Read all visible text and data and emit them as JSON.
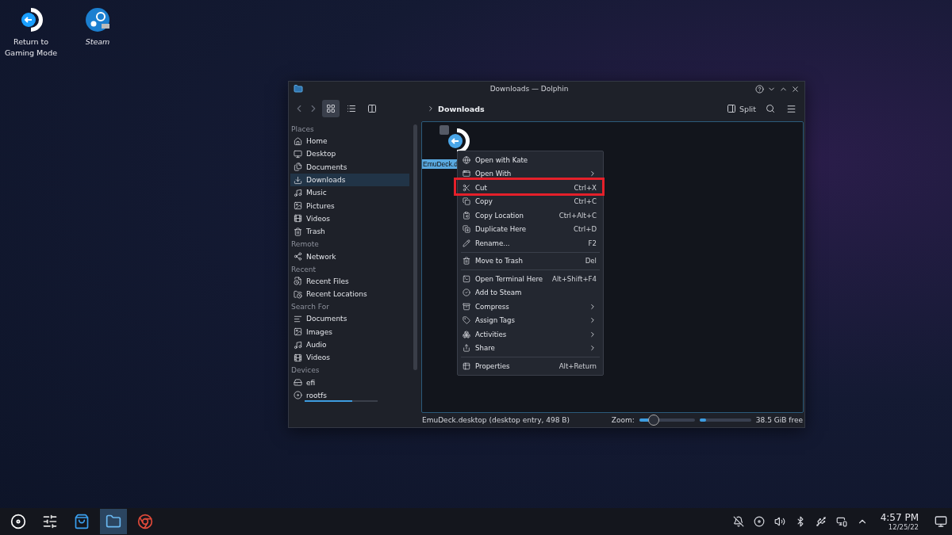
{
  "desktop_icons": [
    {
      "label": "Return to Gaming Mode",
      "italic": false
    },
    {
      "label": "Steam",
      "italic": true
    }
  ],
  "window": {
    "title": "Downloads — Dolphin",
    "view_modes": [
      {
        "selected": true
      },
      {
        "selected": false
      },
      {
        "selected": false
      }
    ],
    "breadcrumb": "Downloads",
    "split_label": "Split",
    "sidebar": [
      {
        "heading": "Places",
        "items": [
          {
            "label": "Home",
            "selected": false
          },
          {
            "label": "Desktop",
            "selected": false
          },
          {
            "label": "Documents",
            "selected": false
          },
          {
            "label": "Downloads",
            "selected": true
          },
          {
            "label": "Music",
            "selected": false
          },
          {
            "label": "Pictures",
            "selected": false
          },
          {
            "label": "Videos",
            "selected": false
          },
          {
            "label": "Trash",
            "selected": false
          }
        ]
      },
      {
        "heading": "Remote",
        "items": [
          {
            "label": "Network",
            "selected": false
          }
        ]
      },
      {
        "heading": "Recent",
        "items": [
          {
            "label": "Recent Files",
            "selected": false
          },
          {
            "label": "Recent Locations",
            "selected": false
          }
        ]
      },
      {
        "heading": "Search For",
        "items": [
          {
            "label": "Documents",
            "selected": false
          },
          {
            "label": "Images",
            "selected": false
          },
          {
            "label": "Audio",
            "selected": false
          },
          {
            "label": "Videos",
            "selected": false
          }
        ]
      },
      {
        "heading": "Devices",
        "items": [
          {
            "label": "efi",
            "selected": false
          },
          {
            "label": "rootfs",
            "selected": false,
            "level": 0.65
          }
        ]
      }
    ],
    "file": {
      "name": "EmuDeck.d",
      "selected": true
    },
    "context_menu": [
      {
        "kind": "item",
        "label": "Open with Kate"
      },
      {
        "kind": "item",
        "label": "Open With",
        "submenu": true
      },
      {
        "kind": "item",
        "label": "Cut",
        "shortcut": "Ctrl+X",
        "highlighted": true
      },
      {
        "kind": "item",
        "label": "Copy",
        "shortcut": "Ctrl+C"
      },
      {
        "kind": "item",
        "label": "Copy Location",
        "shortcut": "Ctrl+Alt+C"
      },
      {
        "kind": "item",
        "label": "Duplicate Here",
        "shortcut": "Ctrl+D"
      },
      {
        "kind": "item",
        "label": "Rename...",
        "shortcut": "F2"
      },
      {
        "kind": "separator"
      },
      {
        "kind": "item",
        "label": "Move to Trash",
        "shortcut": "Del"
      },
      {
        "kind": "separator"
      },
      {
        "kind": "item",
        "label": "Open Terminal Here",
        "shortcut": "Alt+Shift+F4"
      },
      {
        "kind": "item",
        "label": "Add to Steam"
      },
      {
        "kind": "item",
        "label": "Compress",
        "submenu": true
      },
      {
        "kind": "item",
        "label": "Assign Tags",
        "submenu": true
      },
      {
        "kind": "item",
        "label": "Activities",
        "submenu": true
      },
      {
        "kind": "item",
        "label": "Share",
        "submenu": true
      },
      {
        "kind": "separator"
      },
      {
        "kind": "item",
        "label": "Properties",
        "shortcut": "Alt+Return"
      }
    ],
    "status_bar": {
      "text": "EmuDeck.desktop (desktop entry, 498 B)",
      "zoom_label": "Zoom:",
      "zoom": {
        "level": 0.25
      },
      "space": {
        "level": 0.12
      },
      "free": "38.5 GiB free"
    }
  },
  "taskbar": {
    "apps": [
      {
        "selected": false
      },
      {
        "selected": false
      },
      {
        "selected": false
      },
      {
        "selected": true
      },
      {
        "selected": false
      }
    ],
    "time": "4:57 PM",
    "date": "12/25/22"
  }
}
